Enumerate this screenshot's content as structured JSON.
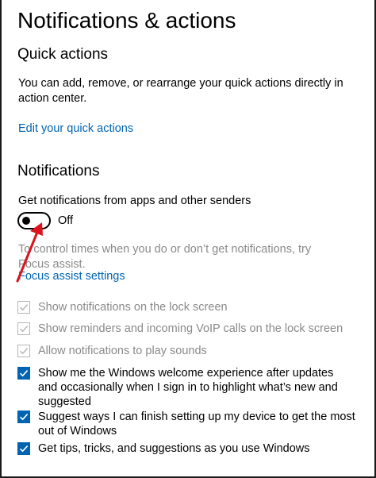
{
  "header": {
    "title": "Notifications & actions"
  },
  "quick_actions": {
    "title": "Quick actions",
    "description": "You can add, remove, or rearrange your quick actions directly in action center.",
    "edit_link": "Edit your quick actions"
  },
  "notifications": {
    "title": "Notifications",
    "get_label": "Get notifications from apps and other senders",
    "toggle": {
      "state": "Off",
      "on": false
    },
    "focus_description": "To control times when you do or don’t get notifications, try Focus assist.",
    "focus_link": "Focus assist settings",
    "options": [
      {
        "label": "Show notifications on the lock screen",
        "checked": true,
        "enabled": false
      },
      {
        "label": "Show reminders and incoming VoIP calls on the lock screen",
        "checked": true,
        "enabled": false
      },
      {
        "label": "Allow notifications to play sounds",
        "checked": true,
        "enabled": false
      },
      {
        "label": "Show me the Windows welcome experience after updates and occasionally when I sign in to highlight what’s new and suggested",
        "checked": true,
        "enabled": true
      },
      {
        "label": "Suggest ways I can finish setting up my device to get the most out of Windows",
        "checked": true,
        "enabled": true
      },
      {
        "label": "Get tips, tricks, and suggestions as you use Windows",
        "checked": true,
        "enabled": true
      }
    ]
  },
  "colors": {
    "accent": "#0063b1",
    "disabled_text": "#8a8a8a",
    "annotation_arrow": "#d9141e"
  }
}
